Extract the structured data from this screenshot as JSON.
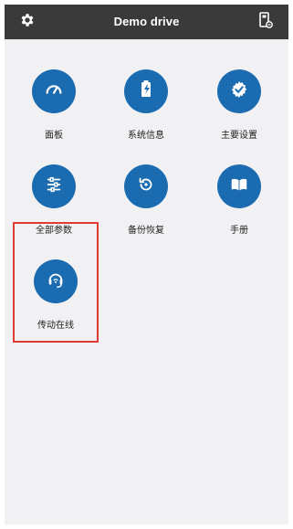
{
  "app": {
    "title": "Demo drive"
  },
  "header": {
    "left_icon": "gear-icon",
    "right_icon": "device-icon"
  },
  "tiles": [
    {
      "label": "面板",
      "icon": "gauge-icon"
    },
    {
      "label": "系统信息",
      "icon": "battery-icon"
    },
    {
      "label": "主要设置",
      "icon": "settings-check-icon"
    },
    {
      "label": "全部参数",
      "icon": "sliders-icon"
    },
    {
      "label": "备份恢复",
      "icon": "restore-icon"
    },
    {
      "label": "手册",
      "icon": "book-icon"
    },
    {
      "label": "传动在线",
      "icon": "headset-icon"
    }
  ],
  "colors": {
    "header_bg": "#3a3a3a",
    "content_bg": "#f1f1f4",
    "accent": "#1b6bb0",
    "highlight": "#e03a33"
  }
}
